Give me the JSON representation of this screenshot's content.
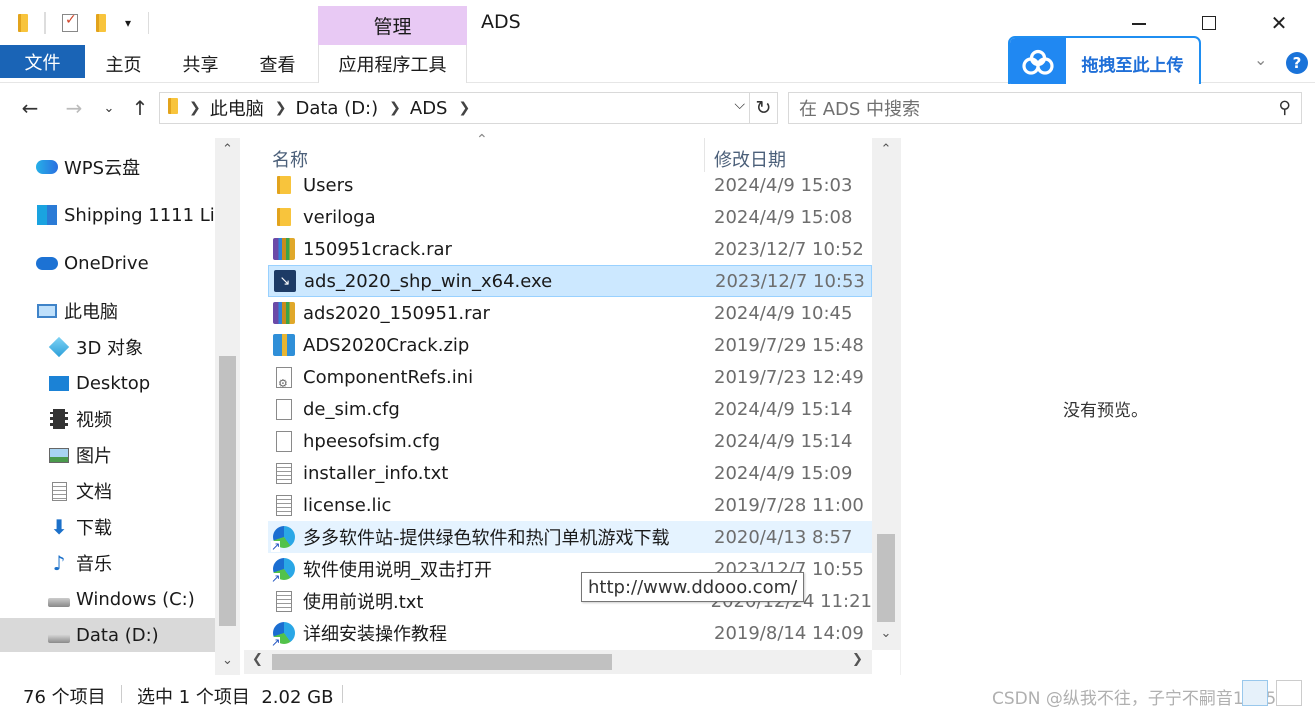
{
  "window": {
    "title": "ADS",
    "context_tab": "管理",
    "minimize_glyph": "—",
    "close_glyph": "✕"
  },
  "ribbon": {
    "tabs": [
      "文件",
      "主页",
      "共享",
      "查看",
      "应用程序工具"
    ],
    "upload_label": "拖拽至此上传",
    "help_glyph": "?"
  },
  "address": {
    "crumbs": [
      "此电脑",
      "Data (D:)",
      "ADS"
    ],
    "search_placeholder": "在 ADS 中搜索"
  },
  "nav": {
    "items": [
      {
        "label": "WPS云盘",
        "icon": "wps-cloud-icon"
      },
      {
        "label": "Shipping 1111 Li",
        "icon": "shipping-icon"
      },
      {
        "label": "OneDrive",
        "icon": "onedrive-icon"
      },
      {
        "label": "此电脑",
        "icon": "this-pc-icon"
      },
      {
        "label": "3D 对象",
        "icon": "3d-objects-icon"
      },
      {
        "label": "Desktop",
        "icon": "desktop-icon"
      },
      {
        "label": "视频",
        "icon": "video-icon"
      },
      {
        "label": "图片",
        "icon": "pictures-icon"
      },
      {
        "label": "文档",
        "icon": "documents-icon"
      },
      {
        "label": "下载",
        "icon": "download-icon"
      },
      {
        "label": "音乐",
        "icon": "music-icon"
      },
      {
        "label": "Windows (C:)",
        "icon": "drive-c-icon"
      },
      {
        "label": "Data (D:)",
        "icon": "drive-d-icon"
      }
    ],
    "selected": "Data (D:)"
  },
  "list": {
    "columns": {
      "name": "名称",
      "date": "修改日期"
    },
    "files": [
      {
        "name": "Users",
        "date": "2024/4/9 15:03",
        "icon": "folder-icon"
      },
      {
        "name": "veriloga",
        "date": "2024/4/9 15:08",
        "icon": "folder-icon"
      },
      {
        "name": "150951crack.rar",
        "date": "2023/12/7 10:52",
        "icon": "rar-archive-icon"
      },
      {
        "name": "ads_2020_shp_win_x64.exe",
        "date": "2023/12/7 10:53",
        "icon": "installer-exe-icon"
      },
      {
        "name": "ads2020_150951.rar",
        "date": "2024/4/9 10:45",
        "icon": "rar-archive-icon"
      },
      {
        "name": "ADS2020Crack.zip",
        "date": "2019/7/29 15:48",
        "icon": "zip-archive-icon"
      },
      {
        "name": "ComponentRefs.ini",
        "date": "2019/7/23 12:49",
        "icon": "ini-settings-icon"
      },
      {
        "name": "de_sim.cfg",
        "date": "2024/4/9 15:14",
        "icon": "blank-file-icon"
      },
      {
        "name": "hpeesofsim.cfg",
        "date": "2024/4/9 15:14",
        "icon": "blank-file-icon"
      },
      {
        "name": "installer_info.txt",
        "date": "2024/4/9 15:09",
        "icon": "text-file-icon"
      },
      {
        "name": "license.lic",
        "date": "2019/7/28 11:00",
        "icon": "text-file-icon"
      },
      {
        "name": "多多软件站-提供绿色软件和热门单机游戏下载",
        "date": "2020/4/13 8:57",
        "icon": "edge-shortcut-icon"
      },
      {
        "name": "软件使用说明_双击打开",
        "date": "2023/12/7 10:55",
        "icon": "edge-shortcut-icon"
      },
      {
        "name": "使用前说明.txt",
        "date": "2020/12/24 11:21",
        "icon": "text-file-icon"
      },
      {
        "name": "详细安装操作教程",
        "date": "2019/8/14 14:09",
        "icon": "edge-shortcut-icon"
      }
    ],
    "selected_file": "ads_2020_shp_win_x64.exe",
    "hovered_file": "多多软件站-提供绿色软件和热门单机游戏下载"
  },
  "tooltip": "http://www.ddooo.com/",
  "preview": {
    "empty_text": "没有预览。"
  },
  "status": {
    "item_count": "76 个项目",
    "selection": "选中 1 个项目  2.02 GB",
    "watermark": "CSDN @纵我不往，子宁不嗣音1995"
  },
  "colors": {
    "accent": "#1a64b6",
    "manage_tab": "#e8c9f4",
    "selection": "#cce8ff",
    "upload_blue": "#2088f2"
  }
}
